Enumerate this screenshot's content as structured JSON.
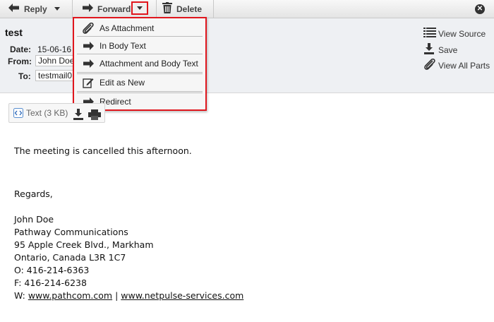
{
  "toolbar": {
    "reply_label": "Reply",
    "forward_label": "Forward",
    "delete_label": "Delete"
  },
  "message": {
    "subject": "test",
    "date_label": "Date:",
    "date_value": "15-06-16",
    "from_label": "From:",
    "from_value": "John Doe",
    "to_label": "To:",
    "to_value": "testmail0"
  },
  "side_actions": {
    "view_source": "View Source",
    "save": "Save",
    "view_all_parts": "View All Parts"
  },
  "forward_menu": {
    "items": [
      {
        "label": "As Attachment",
        "icon": "paperclip-icon"
      },
      {
        "label": "In Body Text",
        "icon": "arrow-right-icon"
      },
      {
        "label": "Attachment and Body Text",
        "icon": "arrow-right-icon"
      },
      {
        "label": "Edit as New",
        "icon": "edit-icon"
      },
      {
        "label": "Redirect",
        "icon": "arrow-right-icon"
      }
    ]
  },
  "attachment": {
    "label": "Text (3 KB)"
  },
  "body": {
    "line1": "The meeting is cancelled this afternoon.",
    "regards": "Regards,",
    "sig_name": "John Doe",
    "sig_company": "Pathway Communications",
    "sig_address1": "95 Apple Creek Blvd., Markham",
    "sig_address2": "Ontario, Canada L3R 1C7",
    "sig_phone": "O: 416-214-6363",
    "sig_fax": "F: 416-214-6238",
    "sig_web_prefix": "W: ",
    "sig_web_link1": "www.pathcom.com",
    "sig_web_sep": " | ",
    "sig_web_link2": "www.netpulse-services.com"
  },
  "colors": {
    "highlight_red": "#e0161d",
    "header_bg": "#eef0f3"
  }
}
